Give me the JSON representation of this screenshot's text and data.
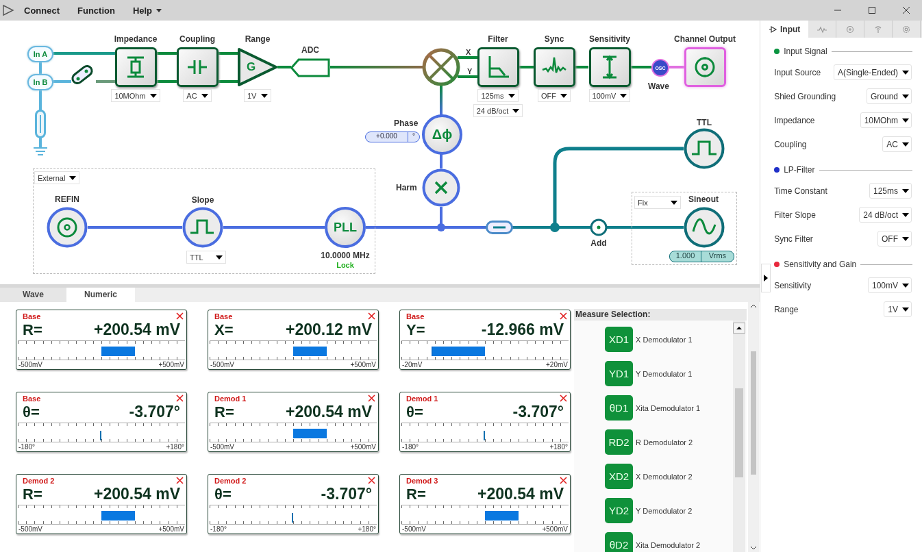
{
  "menu": [
    {
      "label": "Connect",
      "has_dropdown": false
    },
    {
      "label": "Function",
      "has_dropdown": false
    },
    {
      "label": "Help",
      "has_dropdown": true
    }
  ],
  "diagram": {
    "inputs": [
      "In A",
      "In B"
    ],
    "blocks": [
      {
        "kind": "impedance",
        "label": "Impedance",
        "options": [
          "10MOhm"
        ]
      },
      {
        "kind": "coupling",
        "label": "Coupling",
        "options": [
          "AC"
        ]
      },
      {
        "kind": "gain",
        "label": "Range",
        "symbol": "G",
        "options": [
          "1V"
        ]
      },
      {
        "kind": "adc",
        "label": "ADC"
      },
      {
        "kind": "filter",
        "label": "Filter",
        "options": [
          "125ms",
          "24 dB/oct"
        ]
      },
      {
        "kind": "sync",
        "label": "Sync",
        "options": [
          "OFF"
        ]
      },
      {
        "kind": "sensitivity",
        "label": "Sensitivity",
        "options": [
          "100mV"
        ]
      },
      {
        "kind": "output",
        "label": "Channel Output"
      }
    ],
    "mixer_outputs": [
      "X",
      "Y"
    ],
    "osc": {
      "symbol": "OSC",
      "label": "Wave"
    },
    "phase": {
      "label": "Phase",
      "symbol": "Δϕ",
      "value": "+0.000",
      "unit": "°"
    },
    "harm": {
      "label": "Harm"
    },
    "reference": {
      "source": "External",
      "refin": "REFIN",
      "slope_label": "Slope",
      "slope_option": "TTL",
      "pll_symbol": "PLL",
      "frequency": "10.0000 MHz",
      "status": "Lock"
    },
    "add": {
      "label": "Add"
    },
    "ttl": {
      "label": "TTL"
    },
    "sineout": {
      "mode": "Fix",
      "label": "Sineout",
      "value": "1.000",
      "unit": "Vrms"
    }
  },
  "side_panel": {
    "tabs": [
      {
        "kind": "input",
        "label": "Input",
        "selected": true
      },
      {
        "kind": "wave",
        "selected": false
      },
      {
        "kind": "target",
        "selected": false
      },
      {
        "kind": "signal",
        "selected": false
      },
      {
        "kind": "gear",
        "selected": false
      }
    ],
    "sections": [
      {
        "title": "Input Signal",
        "color": "#0a9440",
        "fields": [
          {
            "label": "Input Source",
            "value": "A(Single-Ended)"
          },
          {
            "label": "Shied Grounding",
            "value": "Ground"
          },
          {
            "label": "Impedance",
            "value": "10MOhm"
          },
          {
            "label": "Coupling",
            "value": "AC"
          }
        ]
      },
      {
        "title": "LP-Filter",
        "color": "#2030c8",
        "fields": [
          {
            "label": "Time Constant",
            "value": "125ms"
          },
          {
            "label": "Filter Slope",
            "value": "24 dB/oct"
          },
          {
            "label": "Sync Filter",
            "value": "OFF"
          }
        ]
      },
      {
        "title": "Sensitivity and Gain",
        "color": "#e8283c",
        "fields": [
          {
            "label": "Sensitivity",
            "value": "100mV"
          },
          {
            "label": "Range",
            "value": "1V"
          }
        ]
      }
    ]
  },
  "bottom_tabs": [
    {
      "label": "Wave",
      "selected": false
    },
    {
      "label": "Numeric",
      "selected": true
    }
  ],
  "meters": [
    {
      "source": "Base",
      "quantity": "R=",
      "value": "+200.54 mV",
      "kind": "bar",
      "level": 0.7,
      "min": "-500mV",
      "max": "+500mV"
    },
    {
      "source": "Base",
      "quantity": "X=",
      "value": "+200.12 mV",
      "kind": "bar",
      "level": 0.7,
      "min": "-500mV",
      "max": "+500mV"
    },
    {
      "source": "Base",
      "quantity": "Y=",
      "value": "-12.966 mV",
      "kind": "bar",
      "level": 0.18,
      "min": "-20mV",
      "max": "+20mV"
    },
    {
      "source": "Base",
      "quantity": "θ=",
      "value": "-3.707°",
      "kind": "marker",
      "level": 0.49,
      "min": "-180°",
      "max": "+180°"
    },
    {
      "source": "Demod 1",
      "quantity": "R=",
      "value": "+200.54 mV",
      "kind": "bar",
      "level": 0.7,
      "min": "-500mV",
      "max": "+500mV"
    },
    {
      "source": "Demod 1",
      "quantity": "θ=",
      "value": "-3.707°",
      "kind": "marker",
      "level": 0.49,
      "min": "-180°",
      "max": "+180°"
    },
    {
      "source": "Demod 2",
      "quantity": "R=",
      "value": "+200.54 mV",
      "kind": "bar",
      "level": 0.7,
      "min": "-500mV",
      "max": "+500mV"
    },
    {
      "source": "Demod 2",
      "quantity": "θ=",
      "value": "-3.707°",
      "kind": "marker",
      "level": 0.49,
      "min": "-180°",
      "max": "+180°"
    },
    {
      "source": "Demod 3",
      "quantity": "R=",
      "value": "+200.54 mV",
      "kind": "bar",
      "level": 0.7,
      "min": "-500mV",
      "max": "+500mV"
    }
  ],
  "measure_selection": {
    "title": "Measure Selection:",
    "items": [
      {
        "code": "XD1",
        "label": "X Demodulator 1"
      },
      {
        "code": "YD1",
        "label": "Y Demodulator 1"
      },
      {
        "code": "θD1",
        "label": "Xita Demodulator 1"
      },
      {
        "code": "RD2",
        "label": "R Demodulator 2"
      },
      {
        "code": "XD2",
        "label": "X Demodulator 2"
      },
      {
        "code": "YD2",
        "label": "Y Demodulator 2"
      },
      {
        "code": "θD2",
        "label": "Xita Demodulator 2"
      }
    ]
  }
}
